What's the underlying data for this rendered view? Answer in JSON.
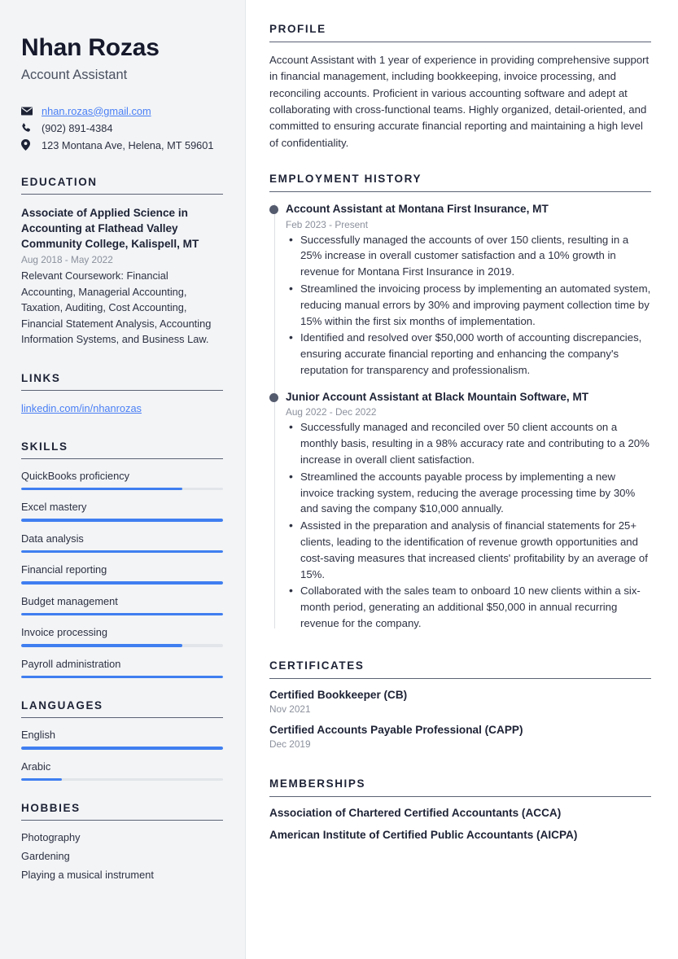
{
  "header": {
    "name": "Nhan Rozas",
    "job_title": "Account Assistant",
    "contacts": [
      {
        "icon": "envelope-icon",
        "text": "nhan.rozas@gmail.com",
        "is_link": true
      },
      {
        "icon": "phone-icon",
        "text": "(902) 891-4384",
        "is_link": false
      },
      {
        "icon": "location-pin-icon",
        "text": "123 Montana Ave, Helena, MT 59601",
        "is_link": false
      }
    ]
  },
  "sidebar": {
    "education": {
      "heading": "EDUCATION",
      "degree": "Associate of Applied Science in Accounting at Flathead Valley Community College, Kalispell, MT",
      "date": "Aug 2018 - May 2022",
      "description": "Relevant Coursework: Financial Accounting, Managerial Accounting, Taxation, Auditing, Cost Accounting, Financial Statement Analysis, Accounting Information Systems, and Business Law."
    },
    "links": {
      "heading": "LINKS",
      "items": [
        {
          "label": "linkedin.com/in/nhanrozas"
        }
      ]
    },
    "skills": {
      "heading": "SKILLS",
      "items": [
        {
          "label": "QuickBooks proficiency",
          "level": 80
        },
        {
          "label": "Excel mastery",
          "level": 100
        },
        {
          "label": "Data analysis",
          "level": 100
        },
        {
          "label": "Financial reporting",
          "level": 100
        },
        {
          "label": "Budget management",
          "level": 100
        },
        {
          "label": "Invoice processing",
          "level": 80
        },
        {
          "label": "Payroll administration",
          "level": 100
        }
      ]
    },
    "languages": {
      "heading": "LANGUAGES",
      "items": [
        {
          "label": "English",
          "level": 100
        },
        {
          "label": "Arabic",
          "level": 20
        }
      ]
    },
    "hobbies": {
      "heading": "HOBBIES",
      "items": [
        {
          "label": "Photography"
        },
        {
          "label": "Gardening"
        },
        {
          "label": "Playing a musical instrument"
        }
      ]
    }
  },
  "main": {
    "profile": {
      "heading": "PROFILE",
      "text": "Account Assistant with 1 year of experience in providing comprehensive support in financial management, including bookkeeping, invoice processing, and reconciling accounts. Proficient in various accounting software and adept at collaborating with cross-functional teams. Highly organized, detail-oriented, and committed to ensuring accurate financial reporting and maintaining a high level of confidentiality."
    },
    "employment": {
      "heading": "EMPLOYMENT HISTORY",
      "jobs": [
        {
          "title": "Account Assistant at Montana First Insurance, MT",
          "date": "Feb 2023 - Present",
          "bullets": [
            "Successfully managed the accounts of over 150 clients, resulting in a 25% increase in overall customer satisfaction and a 10% growth in revenue for Montana First Insurance in 2019.",
            "Streamlined the invoicing process by implementing an automated system, reducing manual errors by 30% and improving payment collection time by 15% within the first six months of implementation.",
            "Identified and resolved over $50,000 worth of accounting discrepancies, ensuring accurate financial reporting and enhancing the company's reputation for transparency and professionalism."
          ]
        },
        {
          "title": "Junior Account Assistant at Black Mountain Software, MT",
          "date": "Aug 2022 - Dec 2022",
          "bullets": [
            "Successfully managed and reconciled over 50 client accounts on a monthly basis, resulting in a 98% accuracy rate and contributing to a 20% increase in overall client satisfaction.",
            "Streamlined the accounts payable process by implementing a new invoice tracking system, reducing the average processing time by 30% and saving the company $10,000 annually.",
            "Assisted in the preparation and analysis of financial statements for 25+ clients, leading to the identification of revenue growth opportunities and cost-saving measures that increased clients' profitability by an average of 15%.",
            "Collaborated with the sales team to onboard 10 new clients within a six-month period, generating an additional $50,000 in annual recurring revenue for the company."
          ]
        }
      ]
    },
    "certificates": {
      "heading": "CERTIFICATES",
      "items": [
        {
          "title": "Certified Bookkeeper (CB)",
          "date": "Nov 2021"
        },
        {
          "title": "Certified Accounts Payable Professional (CAPP)",
          "date": "Dec 2019"
        }
      ]
    },
    "memberships": {
      "heading": "MEMBERSHIPS",
      "items": [
        {
          "title": "Association of Chartered Certified Accountants (ACCA)"
        },
        {
          "title": "American Institute of Certified Public Accountants (AICPA)"
        }
      ]
    }
  },
  "colors": {
    "accent_blue": "#3f7ef0",
    "link_blue": "#4a7ff5",
    "sidebar_bg": "#f2f4f6",
    "heading_dark": "#1d2235",
    "muted_gray": "#8b909c"
  }
}
